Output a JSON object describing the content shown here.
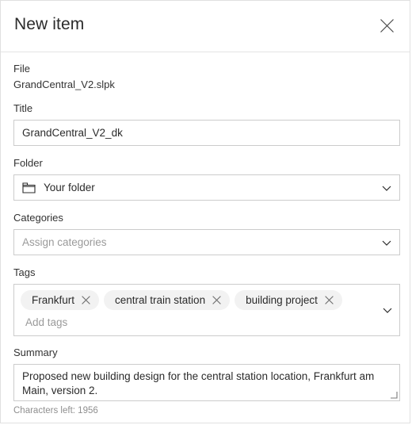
{
  "dialog": {
    "title": "New item",
    "close_label": "Close"
  },
  "fields": {
    "file": {
      "label": "File",
      "value": "GrandCentral_V2.slpk"
    },
    "title": {
      "label": "Title",
      "value": "GrandCentral_V2_dk"
    },
    "folder": {
      "label": "Folder",
      "value": "Your folder",
      "icon": "folder-icon",
      "chevron": "chevron-down-icon"
    },
    "categories": {
      "label": "Categories",
      "placeholder": "Assign categories",
      "chevron": "chevron-down-icon"
    },
    "tags": {
      "label": "Tags",
      "placeholder": "Add tags",
      "chevron": "chevron-down-icon",
      "chips": [
        {
          "label": "Frankfurt",
          "remove": "close-icon"
        },
        {
          "label": "central train station",
          "remove": "close-icon"
        },
        {
          "label": "building project",
          "remove": "close-icon"
        }
      ]
    },
    "summary": {
      "label": "Summary",
      "value": "Proposed new building design for the central station location, Frankfurt am Main, version 2.",
      "characters_left": "Characters left: 1956"
    }
  },
  "colors": {
    "border": "#cccccc",
    "chip_bg": "#f2f2f2",
    "text": "#2b2b2b",
    "muted": "#9a9a9a"
  }
}
